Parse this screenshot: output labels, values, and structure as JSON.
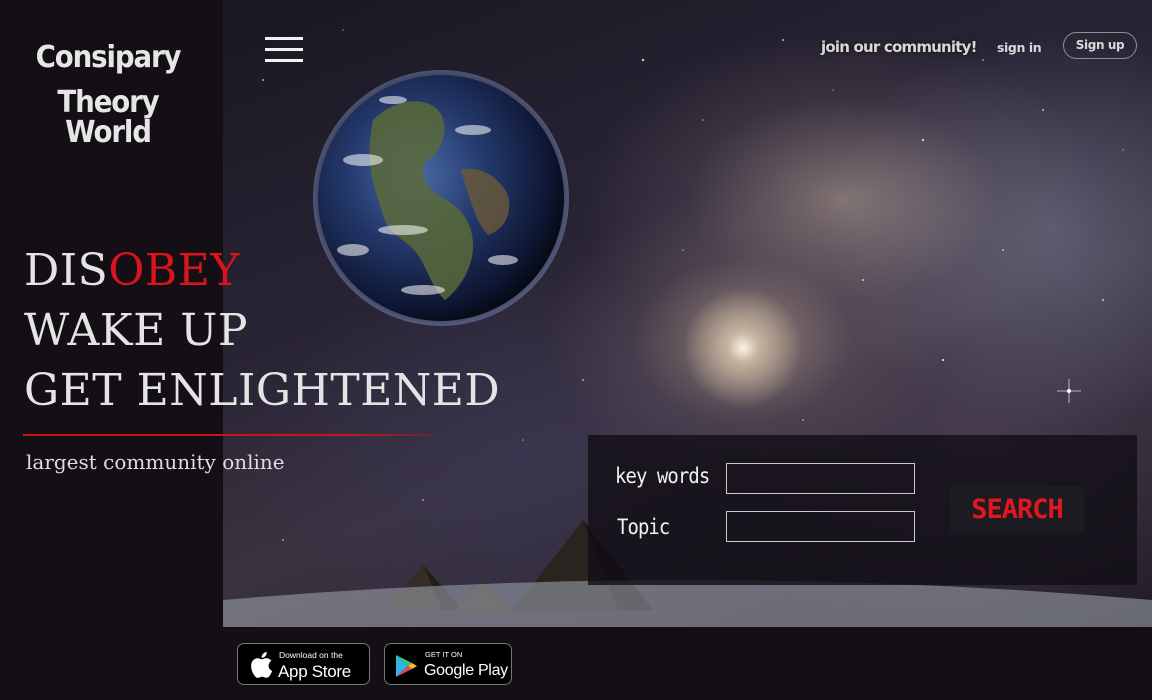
{
  "logo": {
    "line1": "Consipary",
    "line2": "Theory World"
  },
  "nav": {
    "join_label": "join our community!",
    "signin_label": "sign in",
    "signup_label": "Sign up"
  },
  "hero": {
    "slogan": {
      "line1_white": "DIS",
      "line1_red": "OBEY",
      "line2": "WAKE UP",
      "line3": "GET ENLIGHTENED"
    },
    "tagline": "largest community online"
  },
  "search": {
    "keywords_label": "key words",
    "keywords_value": "",
    "topic_label": "Topic",
    "topic_value": "",
    "button_label": "SEARCH"
  },
  "badges": {
    "apple": {
      "small": "Download on the",
      "big": "App Store"
    },
    "google": {
      "small": "GET IT ON",
      "big": "Google Play"
    }
  },
  "colors": {
    "accent_red": "#d8141c",
    "sidebar_bg": "#130f15"
  },
  "icons": [
    "menu-icon",
    "apple-icon",
    "google-play-icon"
  ]
}
